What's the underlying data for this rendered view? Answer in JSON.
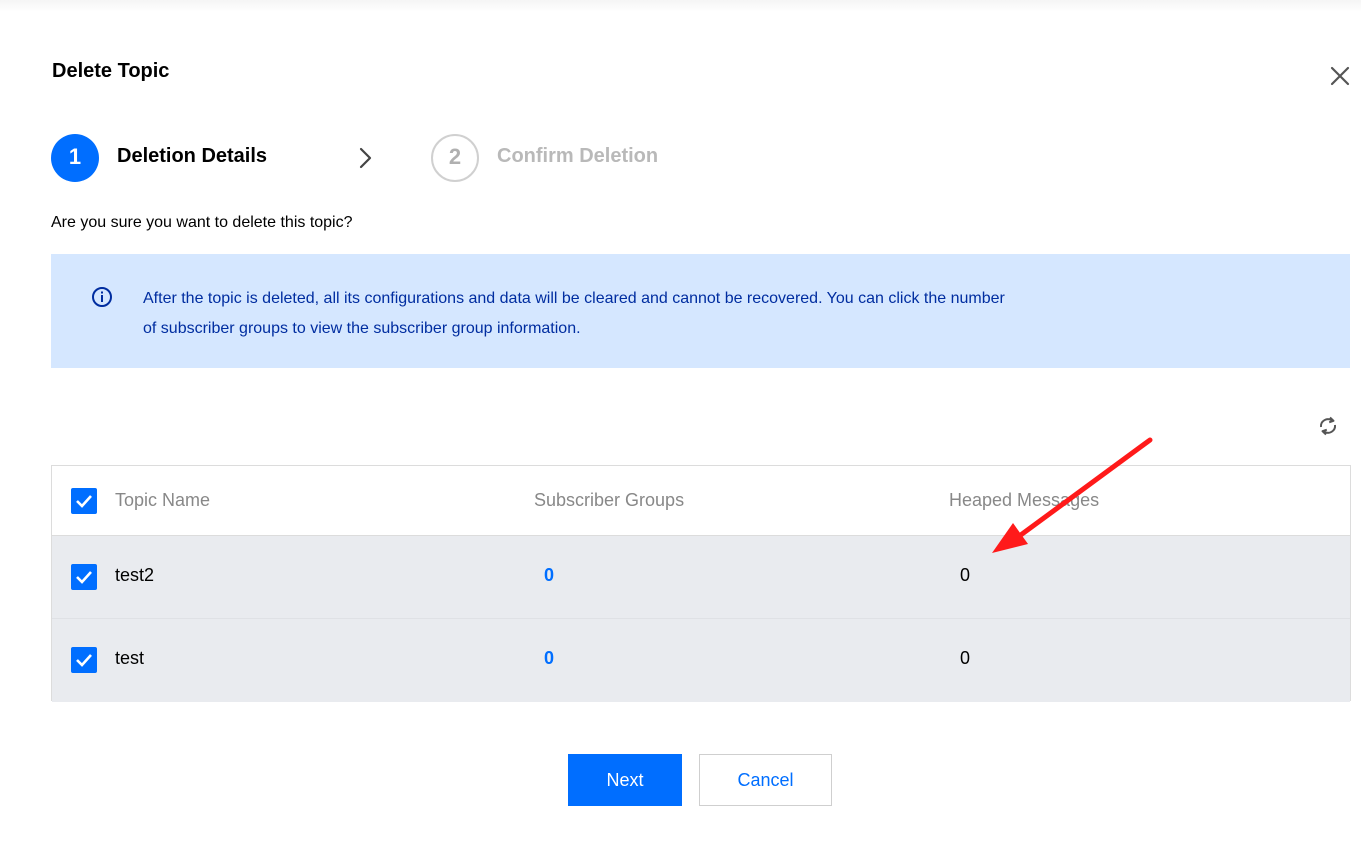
{
  "dialog": {
    "title": "Delete Topic"
  },
  "steps": [
    {
      "number": "1",
      "label": "Deletion Details",
      "state": "active"
    },
    {
      "number": "2",
      "label": "Confirm Deletion",
      "state": "inactive"
    }
  ],
  "question": "Are you sure you want to delete this topic?",
  "notice": {
    "line1": "After the topic is deleted, all its configurations and data will be cleared and cannot be recovered. You can click the number",
    "line2": "of subscriber groups to view the subscriber group information."
  },
  "table": {
    "headers": {
      "topic_name": "Topic Name",
      "subscriber_groups": "Subscriber Groups",
      "heaped_messages": "Heaped Messages"
    },
    "rows": [
      {
        "topic_name": "test2",
        "subscriber_groups": "0",
        "heaped_messages": "0",
        "checked": true
      },
      {
        "topic_name": "test",
        "subscriber_groups": "0",
        "heaped_messages": "0",
        "checked": true
      }
    ]
  },
  "buttons": {
    "next": "Next",
    "cancel": "Cancel"
  },
  "colors": {
    "primary": "#006eff",
    "notice_bg": "#d5e7ff",
    "notice_text": "#002da0",
    "annotation_arrow": "#ff1a1a"
  },
  "icons": {
    "close": "close-icon",
    "step_arrow": "chevron-right-icon",
    "info": "info-icon",
    "refresh": "refresh-icon",
    "checkbox": "checkbox-checked-icon"
  }
}
